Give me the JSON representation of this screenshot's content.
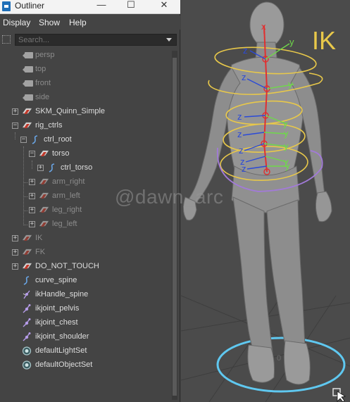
{
  "window": {
    "title": "Outliner",
    "minimize_glyph": "—",
    "maximize_glyph": "☐",
    "close_glyph": "✕"
  },
  "menu": [
    "Display",
    "Show",
    "Help"
  ],
  "search": {
    "placeholder": "Search..."
  },
  "cameras": [
    {
      "label": "persp",
      "icon": "camera-icon"
    },
    {
      "label": "top",
      "icon": "camera-icon"
    },
    {
      "label": "front",
      "icon": "camera-icon"
    },
    {
      "label": "side",
      "icon": "camera-icon"
    }
  ],
  "tree": {
    "skm": "SKM_Quinn_Simple",
    "rig_ctrls": "rig_ctrls",
    "ctrl_root": "ctrl_root",
    "torso": "torso",
    "ctrl_torso": "ctrl_torso",
    "arm_right": "arm_right",
    "arm_left": "arm_left",
    "leg_right": "leg_right",
    "leg_left": "leg_left",
    "ik": "IK",
    "fk": "FK",
    "do_not_touch": "DO_NOT_TOUCH",
    "curve_spine": "curve_spine",
    "ikhandle_spine": "ikHandle_spine",
    "ikjoint_pelvis": "ikjoint_pelvis",
    "ikjoint_chest": "ikjoint_chest",
    "ikjoint_shoulder": "ikjoint_shoulder",
    "default_light_set": "defaultLightSet",
    "default_object_set": "defaultObjectSet"
  },
  "viewport": {
    "ik_label": "IK",
    "axis_x": "x",
    "axis_y": "y",
    "axis_z": "z",
    "origin_label": "0",
    "watermark": "@dawn_arc"
  },
  "colors": {
    "panel_bg": "#444444",
    "viewport_bg": "#4b4b4b",
    "control_yellow": "#e8c84a",
    "control_purple": "#a27ad9",
    "root_cyan": "#5fc8f0",
    "joint_red": "#e03030",
    "axis_green": "#6fd84a",
    "axis_blue": "#2b4ad8",
    "curve_blue": "#6aa6e6",
    "joint_purple": "#b59be8"
  }
}
